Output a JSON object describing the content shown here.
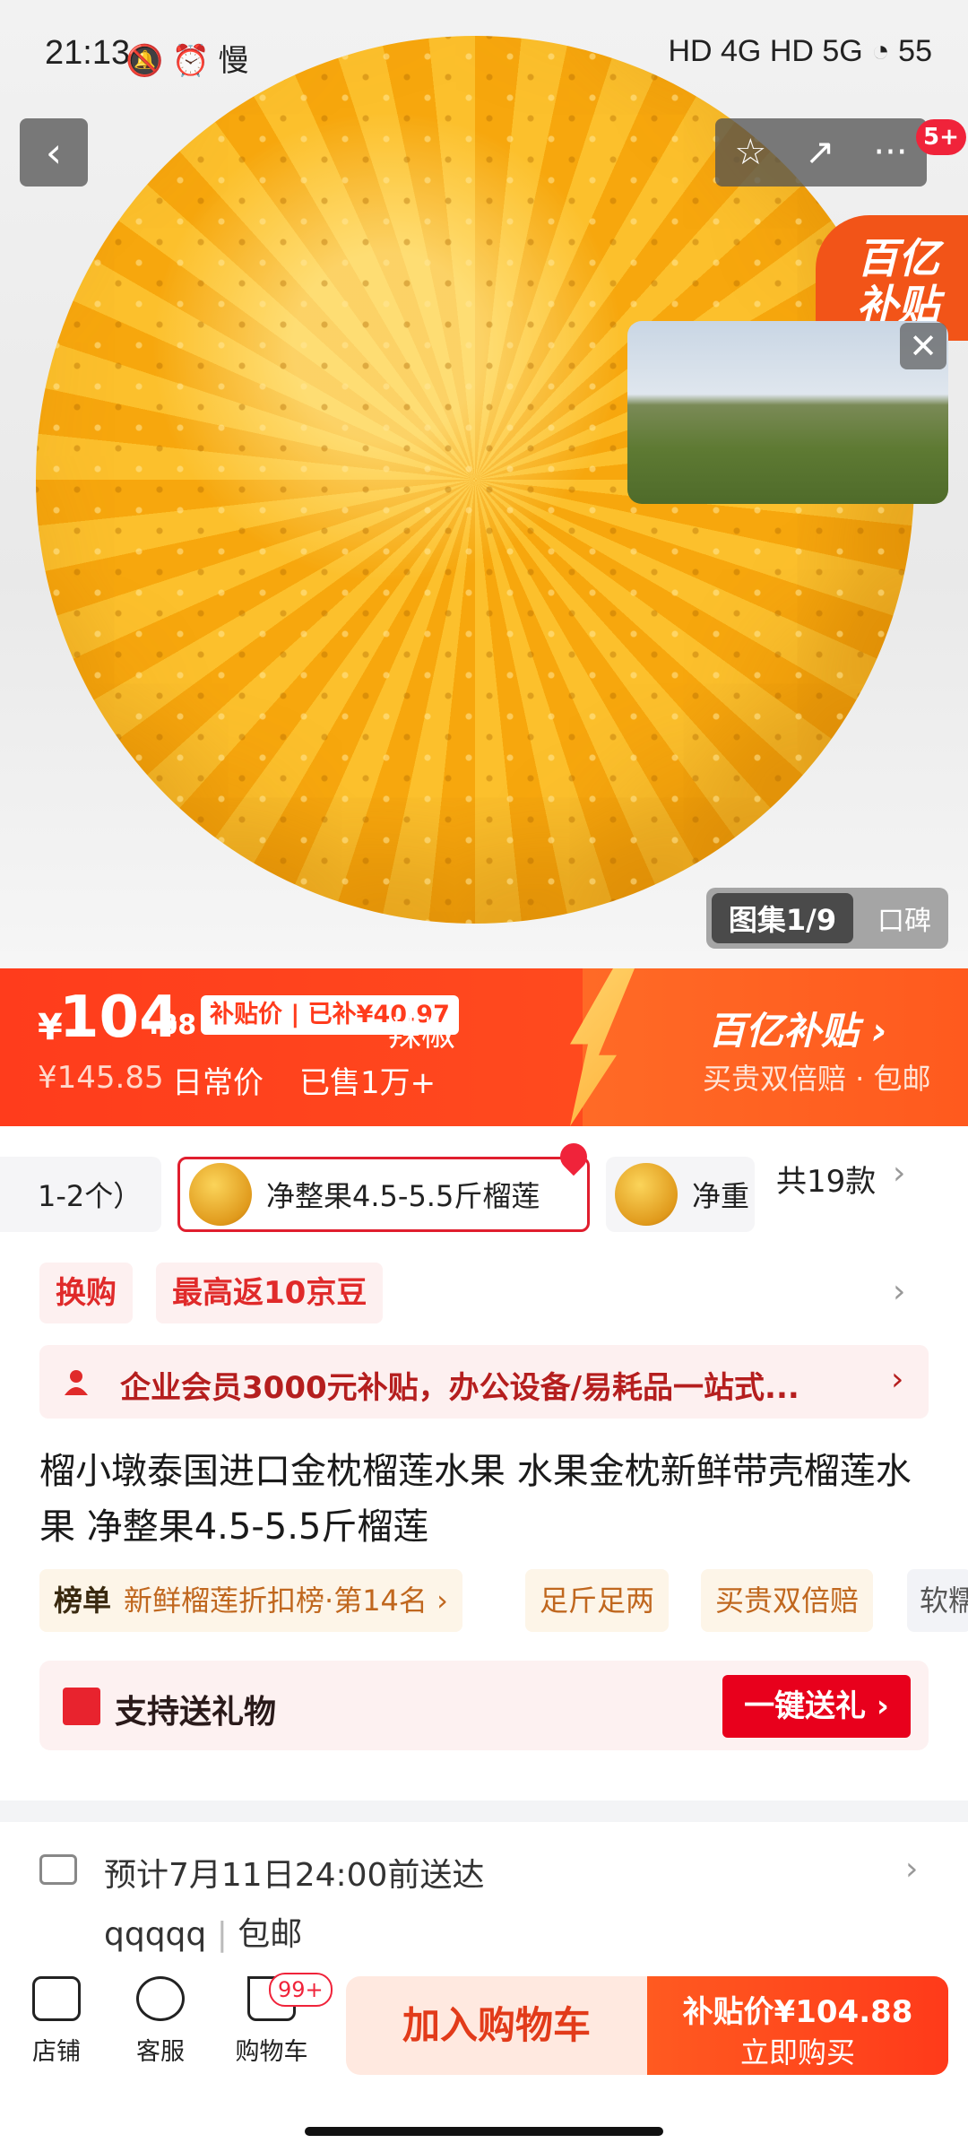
{
  "status_bar": {
    "time": "21:13",
    "left_icons": "🔕 ⏰ 慢",
    "network": "HD 4G  HD 5G",
    "battery": "55"
  },
  "header": {
    "back_icon": "‹",
    "favorite_icon": "☆",
    "share_icon": "↗",
    "more_icon": "···",
    "message_badge": "5+"
  },
  "hero": {
    "corner_badge": "百亿补贴",
    "video_close": "✕",
    "gallery_tab": "图集1/9",
    "review_tab": "口碑"
  },
  "price_banner": {
    "currency": "¥",
    "price_integer": "104",
    "price_decimal": ".88",
    "subsidy_tag": "补贴价 | 已补¥40.97",
    "overlay_text": "辣椒",
    "original_price": "¥145.85",
    "daily_label": "日常价",
    "sold_label": "已售1万+",
    "program_title": "百亿补贴 ›",
    "program_sub": "买贵双倍赔 · 包邮"
  },
  "variants": {
    "partial_chip": "1-2个）",
    "selected_chip": "净整果4.5-5.5斤榴莲",
    "next_chip": "净重",
    "count": "共19款"
  },
  "promos": {
    "swap": "换购",
    "jd_beans": "最高返10京豆",
    "member_banner": "企业会员3000元补贴，办公设备/易耗品一站式..."
  },
  "product": {
    "title": "榴小墩泰国进口金枕榴莲水果 水果金枕新鲜带壳榴莲水果 净整果4.5-5.5斤榴莲",
    "rank_label": "榜单",
    "rank_text": "新鲜榴莲折扣榜·第14名 ›",
    "tag_weight": "足斤足两",
    "tag_compensate": "买贵双倍赔",
    "tag_partial": "软糯"
  },
  "gift": {
    "label": "支持送礼物",
    "button": "一键送礼 ›"
  },
  "delivery": {
    "eta": "预计7月11日24:00前送达",
    "shop": "qqqqq",
    "shipping": "包邮"
  },
  "bottom_bar": {
    "store": "店铺",
    "service": "客服",
    "cart": "购物车",
    "cart_badge": "99+",
    "add_to_cart": "加入购物车",
    "buy_line1": "补贴价¥104.88",
    "buy_line2": "立即购买"
  },
  "colors": {
    "accent_red": "#ff3c1c",
    "gift_red": "#e8001c"
  }
}
